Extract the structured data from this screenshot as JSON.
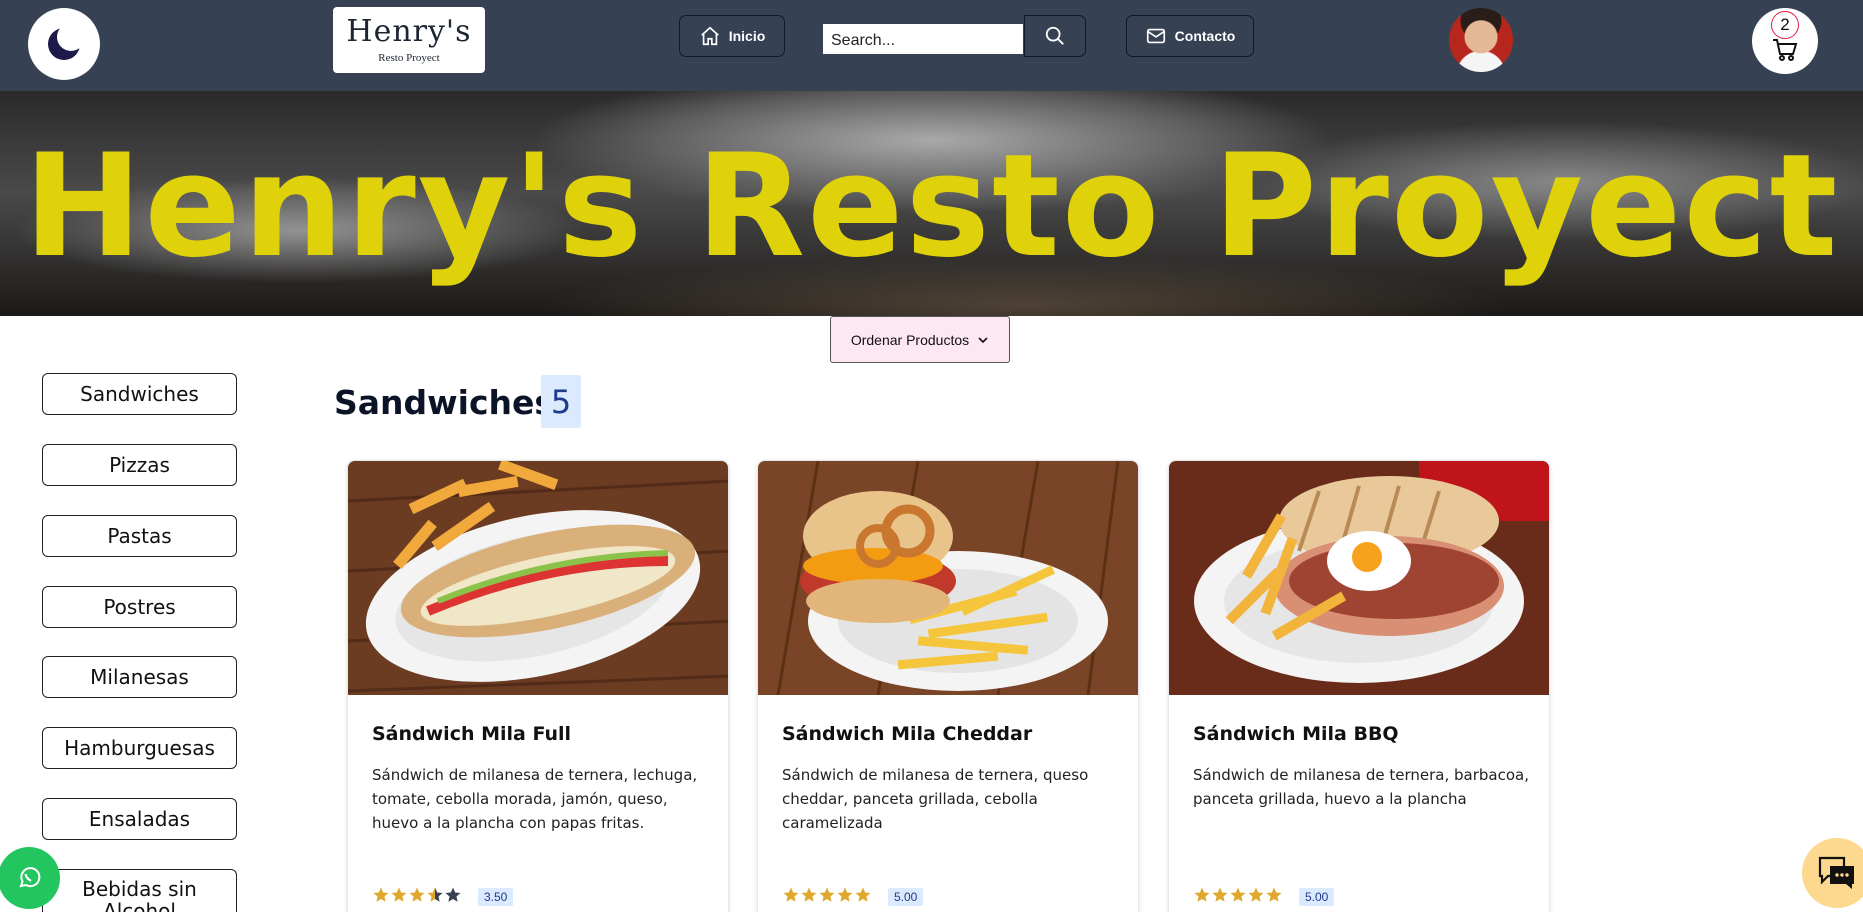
{
  "navbar": {
    "theme_icon": "moon-icon",
    "logo": {
      "main": "Henry's",
      "sub": "Resto Proyect"
    },
    "home_label": "Inicio",
    "search_placeholder": "Search...",
    "contact_label": "Contacto",
    "cart_count": "2"
  },
  "hero": {
    "title": "Henry's Resto Proyect"
  },
  "sort": {
    "label": "Ordenar Productos"
  },
  "sidebar": {
    "categories": [
      "Sandwiches",
      "Pizzas",
      "Pastas",
      "Postres",
      "Milanesas",
      "Hamburguesas",
      "Ensaladas",
      "Bebidas sin Alcohol"
    ]
  },
  "section": {
    "title": "Sandwiches",
    "count": "5"
  },
  "products": [
    {
      "name": "Sándwich Mila Full",
      "description": "Sándwich de milanesa de ternera, lechuga, tomate, cebolla morada, jamón, queso, huevo a la plancha con papas fritas.",
      "rating": 3.5,
      "rating_label": "3.50"
    },
    {
      "name": "Sándwich Mila Cheddar",
      "description": "Sándwich de milanesa de ternera, queso cheddar, panceta grillada, cebolla caramelizada",
      "rating": 5,
      "rating_label": "5.00"
    },
    {
      "name": "Sándwich Mila BBQ",
      "description": "Sándwich de milanesa de ternera, barbacoa, panceta grillada, huevo a la plancha",
      "rating": 5,
      "rating_label": "5.00"
    }
  ],
  "colors": {
    "navbar": "#364153",
    "hero_title": "#e0d20a",
    "star": "#e0a82e",
    "badge_bg": "#dbeafe",
    "whatsapp": "#22c55e",
    "chat": "#fcd98e"
  }
}
